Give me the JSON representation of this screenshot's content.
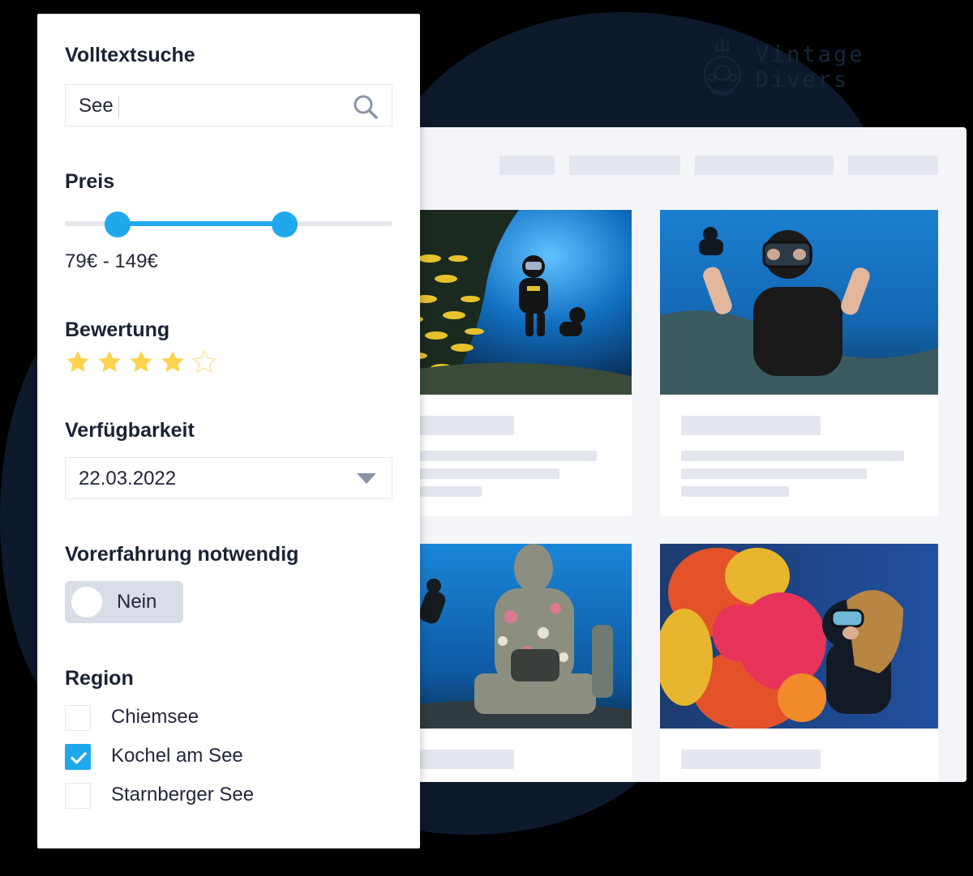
{
  "brand": {
    "name": "Vintage Divers",
    "logo_icon": "diver-helmet-icon"
  },
  "filters": {
    "search": {
      "heading": "Volltextsuche",
      "value": "See",
      "icon": "search-icon"
    },
    "price": {
      "heading": "Preis",
      "range_text": "79€ - 149€",
      "min_fraction": 0.16,
      "max_fraction": 0.67
    },
    "rating": {
      "heading": "Bewertung",
      "value": 4,
      "max": 5,
      "star_color": "#fcd34d"
    },
    "availability": {
      "heading": "Verfügbarkeit",
      "value": "22.03.2022",
      "icon": "chevron-down-icon"
    },
    "experience": {
      "heading": "Vorerfahrung notwendig",
      "toggle_label": "Nein",
      "enabled": false
    },
    "region": {
      "heading": "Region",
      "options": [
        {
          "label": "Chiemsee",
          "checked": false
        },
        {
          "label": "Kochel am See",
          "checked": true
        },
        {
          "label": "Starnberger See",
          "checked": false
        }
      ]
    }
  },
  "colors": {
    "accent": "#20a8ed",
    "panel_background": "#ffffff",
    "backdrop": "#0d1a2b"
  }
}
